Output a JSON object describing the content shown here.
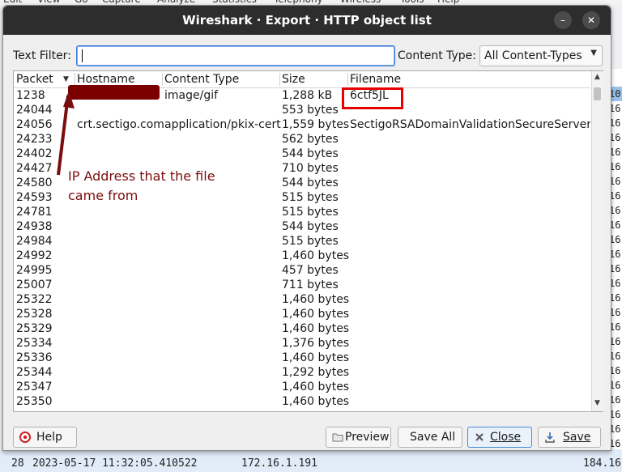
{
  "background": {
    "menubar": [
      "Edit",
      "View",
      "Go",
      "Capture",
      "Analyze",
      "Statistics",
      "Telephony",
      "Wireless",
      "Tools",
      "Help"
    ],
    "right_column": [
      "10",
      "16",
      "16",
      "16",
      "16",
      "16",
      "16",
      "16",
      "16",
      "16",
      "16",
      "16",
      "16",
      "16",
      "16",
      "16",
      "16",
      "16",
      "16",
      "16",
      "16",
      "16",
      "16",
      "16",
      "16"
    ],
    "status_row": {
      "index": "28",
      "timestamp": "2023-05-17 11:32:05.410522",
      "source": "172.16.1.191",
      "destination": "184.16"
    }
  },
  "dialog": {
    "title": "Wireshark · Export · HTTP object list",
    "minimize_glyph": "–",
    "close_glyph": "✕",
    "text_filter_label": "Text Filter:",
    "text_filter_value": "",
    "content_type_label": "Content Type:",
    "content_type_value": "All Content-Types",
    "columns": [
      "Packet",
      "Hostname",
      "Content Type",
      "Size",
      "Filename"
    ],
    "rows": [
      {
        "packet": "1238",
        "hostname": "",
        "content_type": "image/gif",
        "size": "1,288 kB",
        "filename": "6ctf5JL"
      },
      {
        "packet": "24044",
        "hostname": "",
        "content_type": "",
        "size": "553 bytes",
        "filename": ""
      },
      {
        "packet": "24056",
        "hostname": "crt.sectigo.com",
        "content_type": "application/pkix-cert",
        "size": "1,559 bytes",
        "filename": "SectigoRSADomainValidationSecureServerCA"
      },
      {
        "packet": "24233",
        "hostname": "",
        "content_type": "",
        "size": "562 bytes",
        "filename": ""
      },
      {
        "packet": "24402",
        "hostname": "",
        "content_type": "",
        "size": "544 bytes",
        "filename": ""
      },
      {
        "packet": "24427",
        "hostname": "",
        "content_type": "",
        "size": "710 bytes",
        "filename": ""
      },
      {
        "packet": "24580",
        "hostname": "",
        "content_type": "",
        "size": "544 bytes",
        "filename": ""
      },
      {
        "packet": "24593",
        "hostname": "",
        "content_type": "",
        "size": "515 bytes",
        "filename": ""
      },
      {
        "packet": "24781",
        "hostname": "",
        "content_type": "",
        "size": "515 bytes",
        "filename": ""
      },
      {
        "packet": "24938",
        "hostname": "",
        "content_type": "",
        "size": "544 bytes",
        "filename": ""
      },
      {
        "packet": "24984",
        "hostname": "",
        "content_type": "",
        "size": "515 bytes",
        "filename": ""
      },
      {
        "packet": "24992",
        "hostname": "",
        "content_type": "",
        "size": "1,460 bytes",
        "filename": ""
      },
      {
        "packet": "24995",
        "hostname": "",
        "content_type": "",
        "size": "457 bytes",
        "filename": ""
      },
      {
        "packet": "25007",
        "hostname": "",
        "content_type": "",
        "size": "711 bytes",
        "filename": ""
      },
      {
        "packet": "25322",
        "hostname": "",
        "content_type": "",
        "size": "1,460 bytes",
        "filename": ""
      },
      {
        "packet": "25328",
        "hostname": "",
        "content_type": "",
        "size": "1,460 bytes",
        "filename": ""
      },
      {
        "packet": "25329",
        "hostname": "",
        "content_type": "",
        "size": "1,460 bytes",
        "filename": ""
      },
      {
        "packet": "25334",
        "hostname": "",
        "content_type": "",
        "size": "1,376 bytes",
        "filename": ""
      },
      {
        "packet": "25336",
        "hostname": "",
        "content_type": "",
        "size": "1,460 bytes",
        "filename": ""
      },
      {
        "packet": "25344",
        "hostname": "",
        "content_type": "",
        "size": "1,292 bytes",
        "filename": ""
      },
      {
        "packet": "25347",
        "hostname": "",
        "content_type": "",
        "size": "1,460 bytes",
        "filename": ""
      },
      {
        "packet": "25350",
        "hostname": "",
        "content_type": "",
        "size": "1,460 bytes",
        "filename": ""
      }
    ],
    "annotation": [
      "IP Address that the file",
      "came from"
    ],
    "buttons": {
      "help": "Help",
      "preview": "Preview",
      "save_all": "Save All",
      "close": "Close",
      "save": "Save"
    }
  },
  "colors": {
    "titlebar": "#2d2d2d",
    "redaction": "#7a0000",
    "highlight_box": "#e60000",
    "annotation": "#7a0d0d"
  }
}
